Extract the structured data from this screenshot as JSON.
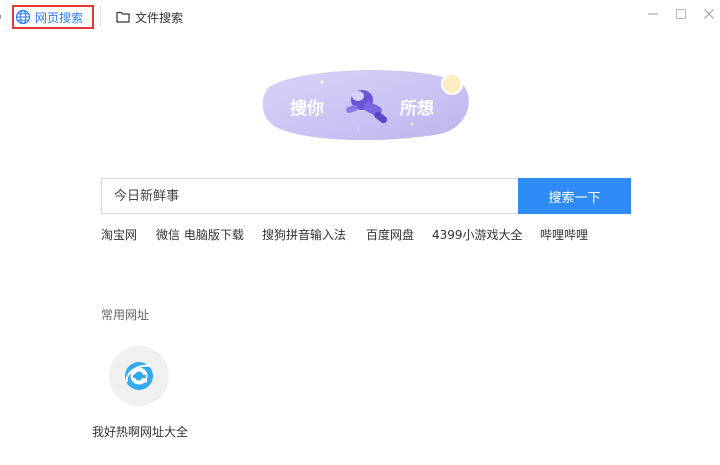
{
  "tabs": {
    "web_search": "网页搜索",
    "file_search": "文件搜索"
  },
  "banner": {
    "text_left": "搜你",
    "text_right": "所想"
  },
  "search": {
    "placeholder": "今日新鲜事",
    "button_label": "搜索一下"
  },
  "quick_links": [
    "淘宝网",
    "微信 电脑版下载",
    "搜狗拼音输入法",
    "百度网盘",
    "4399小游戏大全",
    "哔哩哔哩"
  ],
  "common_sites": {
    "label": "常用网址",
    "items": [
      {
        "label": "我好热啊网址大全",
        "icon": "ie-browser-icon"
      }
    ]
  },
  "colors": {
    "accent": "#2f8cf6",
    "active_tab_text": "#2f7bf5",
    "highlight_border": "#e53935",
    "banner_bg": "#c9c3f3"
  }
}
